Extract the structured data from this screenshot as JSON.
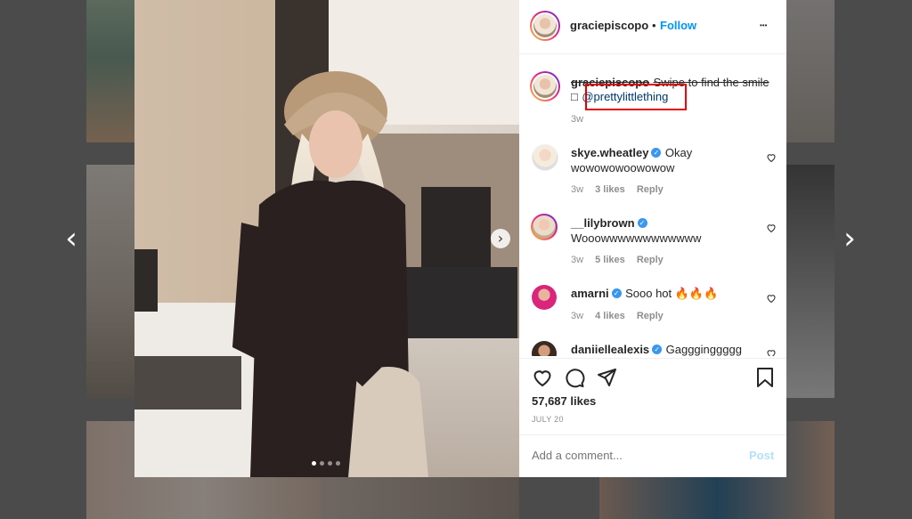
{
  "header": {
    "username": "graciepiscopo",
    "separator": "•",
    "follow_label": "Follow",
    "more_label": "•••"
  },
  "caption": {
    "username": "graciepiscopo",
    "text": "Swipe to find the smile",
    "emoji_placeholder": "□",
    "mention": "@prettylittlething",
    "age": "3w"
  },
  "comments": [
    {
      "username": "skye.wheatley",
      "verified": true,
      "text": "Okay wowowowoowowow",
      "line1": "Okay",
      "line2": "wowowowoowowow",
      "age": "3w",
      "likes": "3 likes",
      "reply": "Reply"
    },
    {
      "username": "__lilybrown",
      "verified": true,
      "text": "Wooowwwwwwwwwwww",
      "age": "3w",
      "likes": "5 likes",
      "reply": "Reply"
    },
    {
      "username": "amarni",
      "verified": true,
      "text": "Sooo hot 🔥🔥🔥",
      "age": "3w",
      "likes": "4 likes",
      "reply": "Reply"
    },
    {
      "username": "daniiellealexis",
      "verified": true,
      "text": "Gaggginggggg"
    }
  ],
  "actions": {
    "likes": "57,687 likes",
    "date": "JULY 20"
  },
  "comment_box": {
    "placeholder": "Add a comment...",
    "post_label": "Post"
  },
  "nav": {
    "prev_arrow": "‹",
    "next_arrow": "›",
    "carousel_next": "›"
  },
  "colors": {
    "accent": "#0095f6",
    "highlight_box": "#e00000",
    "post_disabled": "#b2dffc"
  },
  "carousel": {
    "count": 4,
    "active": 1
  }
}
